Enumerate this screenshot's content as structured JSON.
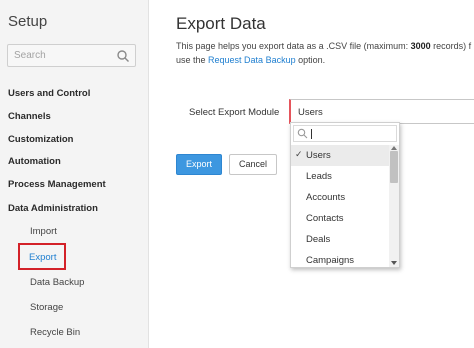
{
  "sidebar": {
    "title": "Setup",
    "search_placeholder": "Search",
    "sections": [
      {
        "label": "Users and Control"
      },
      {
        "label": "Channels"
      },
      {
        "label": "Customization"
      },
      {
        "label": "Automation"
      },
      {
        "label": "Process Management"
      },
      {
        "label": "Data Administration"
      }
    ],
    "sub_items": [
      {
        "label": "Import"
      },
      {
        "label": "Export"
      },
      {
        "label": "Data Backup"
      },
      {
        "label": "Storage"
      },
      {
        "label": "Recycle Bin"
      }
    ],
    "active_item": "Export",
    "highlight_color": "#d32128"
  },
  "main": {
    "title": "Export Data",
    "desc_line1_pre": "This page helps you export data as a .CSV file (maximum: ",
    "desc_line1_bold": "3000",
    "desc_line1_post": " records) f",
    "desc_line2_pre": "use the ",
    "desc_line2_link": "Request Data Backup",
    "desc_line2_post": " option.",
    "field_label": "Select Export Module",
    "selected_module": "Users",
    "export_button": "Export",
    "cancel_button": "Cancel",
    "accent_color": "#3d97e0"
  },
  "dropdown": {
    "search_value": "",
    "selected": "Users",
    "check_glyph": "✓",
    "options": [
      {
        "label": "Users"
      },
      {
        "label": "Leads"
      },
      {
        "label": "Accounts"
      },
      {
        "label": "Contacts"
      },
      {
        "label": "Deals"
      },
      {
        "label": "Campaigns"
      }
    ]
  }
}
